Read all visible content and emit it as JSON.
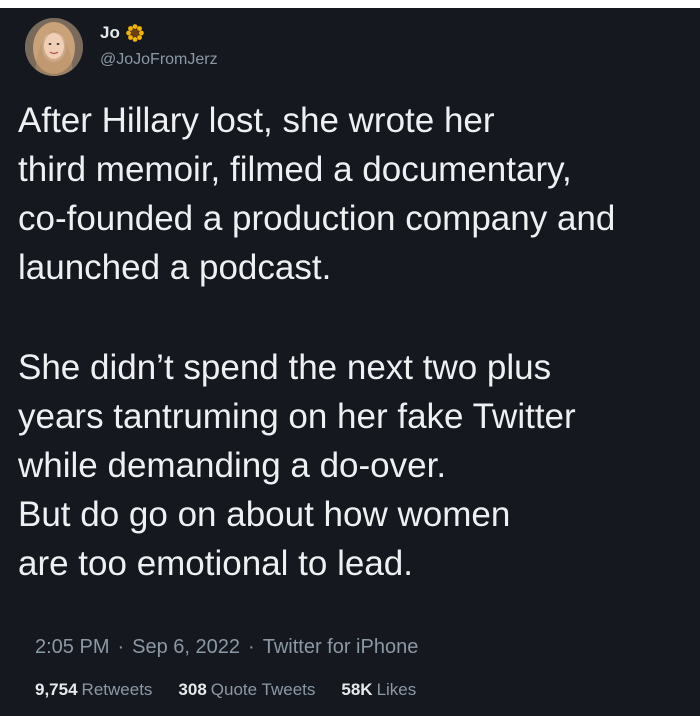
{
  "user": {
    "display_name": "Jo",
    "name_icon": "sunflower-icon",
    "handle": "@JoJoFromJerz"
  },
  "tweet": {
    "paragraph1": "After Hillary lost, she wrote her\nthird memoir, filmed a documentary,\nco-founded a production company and\nlaunched a podcast.",
    "paragraph2": "She didn’t spend the next two plus\nyears tantruming on her fake Twitter\nwhile demanding a do-over.\nBut do go on about how women\nare too emotional to lead."
  },
  "meta": {
    "time": "2:05 PM",
    "date": "Sep 6, 2022",
    "source": "Twitter for iPhone",
    "separator": "·"
  },
  "stats": {
    "retweets_count": "9,754",
    "retweets_label": "Retweets",
    "quotes_count": "308",
    "quotes_label": "Quote Tweets",
    "likes_count": "58K",
    "likes_label": "Likes"
  },
  "colors": {
    "background": "#15181f",
    "text": "#eef0f2",
    "muted": "#8b98a5",
    "sunflower": "#f4b400"
  }
}
